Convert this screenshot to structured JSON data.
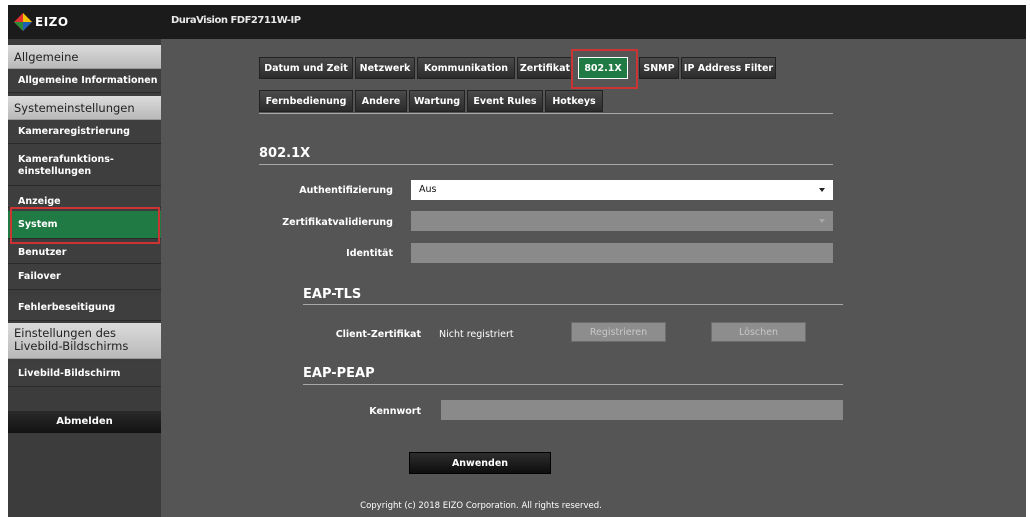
{
  "header": {
    "logo_text": "EIZO",
    "device_name": "DuraVision FDF2711W-IP"
  },
  "sidebar": {
    "sections": [
      {
        "label": "Allgemeine Informationen",
        "items": [
          "Allgemeine Informationen"
        ]
      },
      {
        "label": "Systemeinstellungen",
        "items": [
          "Kameraregistrierung",
          "Kamerafunktions-\neinstellungen",
          "Anzeige",
          "System",
          "Benutzer",
          "Failover",
          "Fehlerbeseitigung"
        ]
      },
      {
        "label": "Einstellungen des Livebild-Bildschirms",
        "items": [
          "Livebild-Bildschirm"
        ]
      }
    ],
    "active_item": "System",
    "logout_label": "Abmelden"
  },
  "tabs": {
    "row1": [
      "Datum und Zeit",
      "Netzwerk",
      "Kommunikation",
      "Zertifikat",
      "802.1X",
      "SNMP",
      "IP Address Filter"
    ],
    "row2": [
      "Fernbedienung",
      "Andere",
      "Wartung",
      "Event Rules",
      "Hotkeys"
    ],
    "active": "802.1X"
  },
  "section_8021x": {
    "title": "802.1X",
    "auth_label": "Authentifizierung",
    "auth_value": "Aus",
    "certval_label": "Zertifikatvalidierung",
    "certval_value": "",
    "identity_label": "Identität",
    "identity_value": ""
  },
  "eap_tls": {
    "title": "EAP-TLS",
    "client_cert_label": "Client-Zertifikat",
    "client_cert_status": "Nicht registriert",
    "register_label": "Registrieren",
    "delete_label": "Löschen"
  },
  "eap_peap": {
    "title": "EAP-PEAP",
    "password_label": "Kennwort",
    "password_value": ""
  },
  "apply_label": "Anwenden",
  "copyright": "Copyright (c) 2018 EIZO Corporation. All rights reserved.",
  "colors": {
    "accent_green": "#1f7a44",
    "highlight_red": "#cc3333",
    "background": "#555555"
  }
}
